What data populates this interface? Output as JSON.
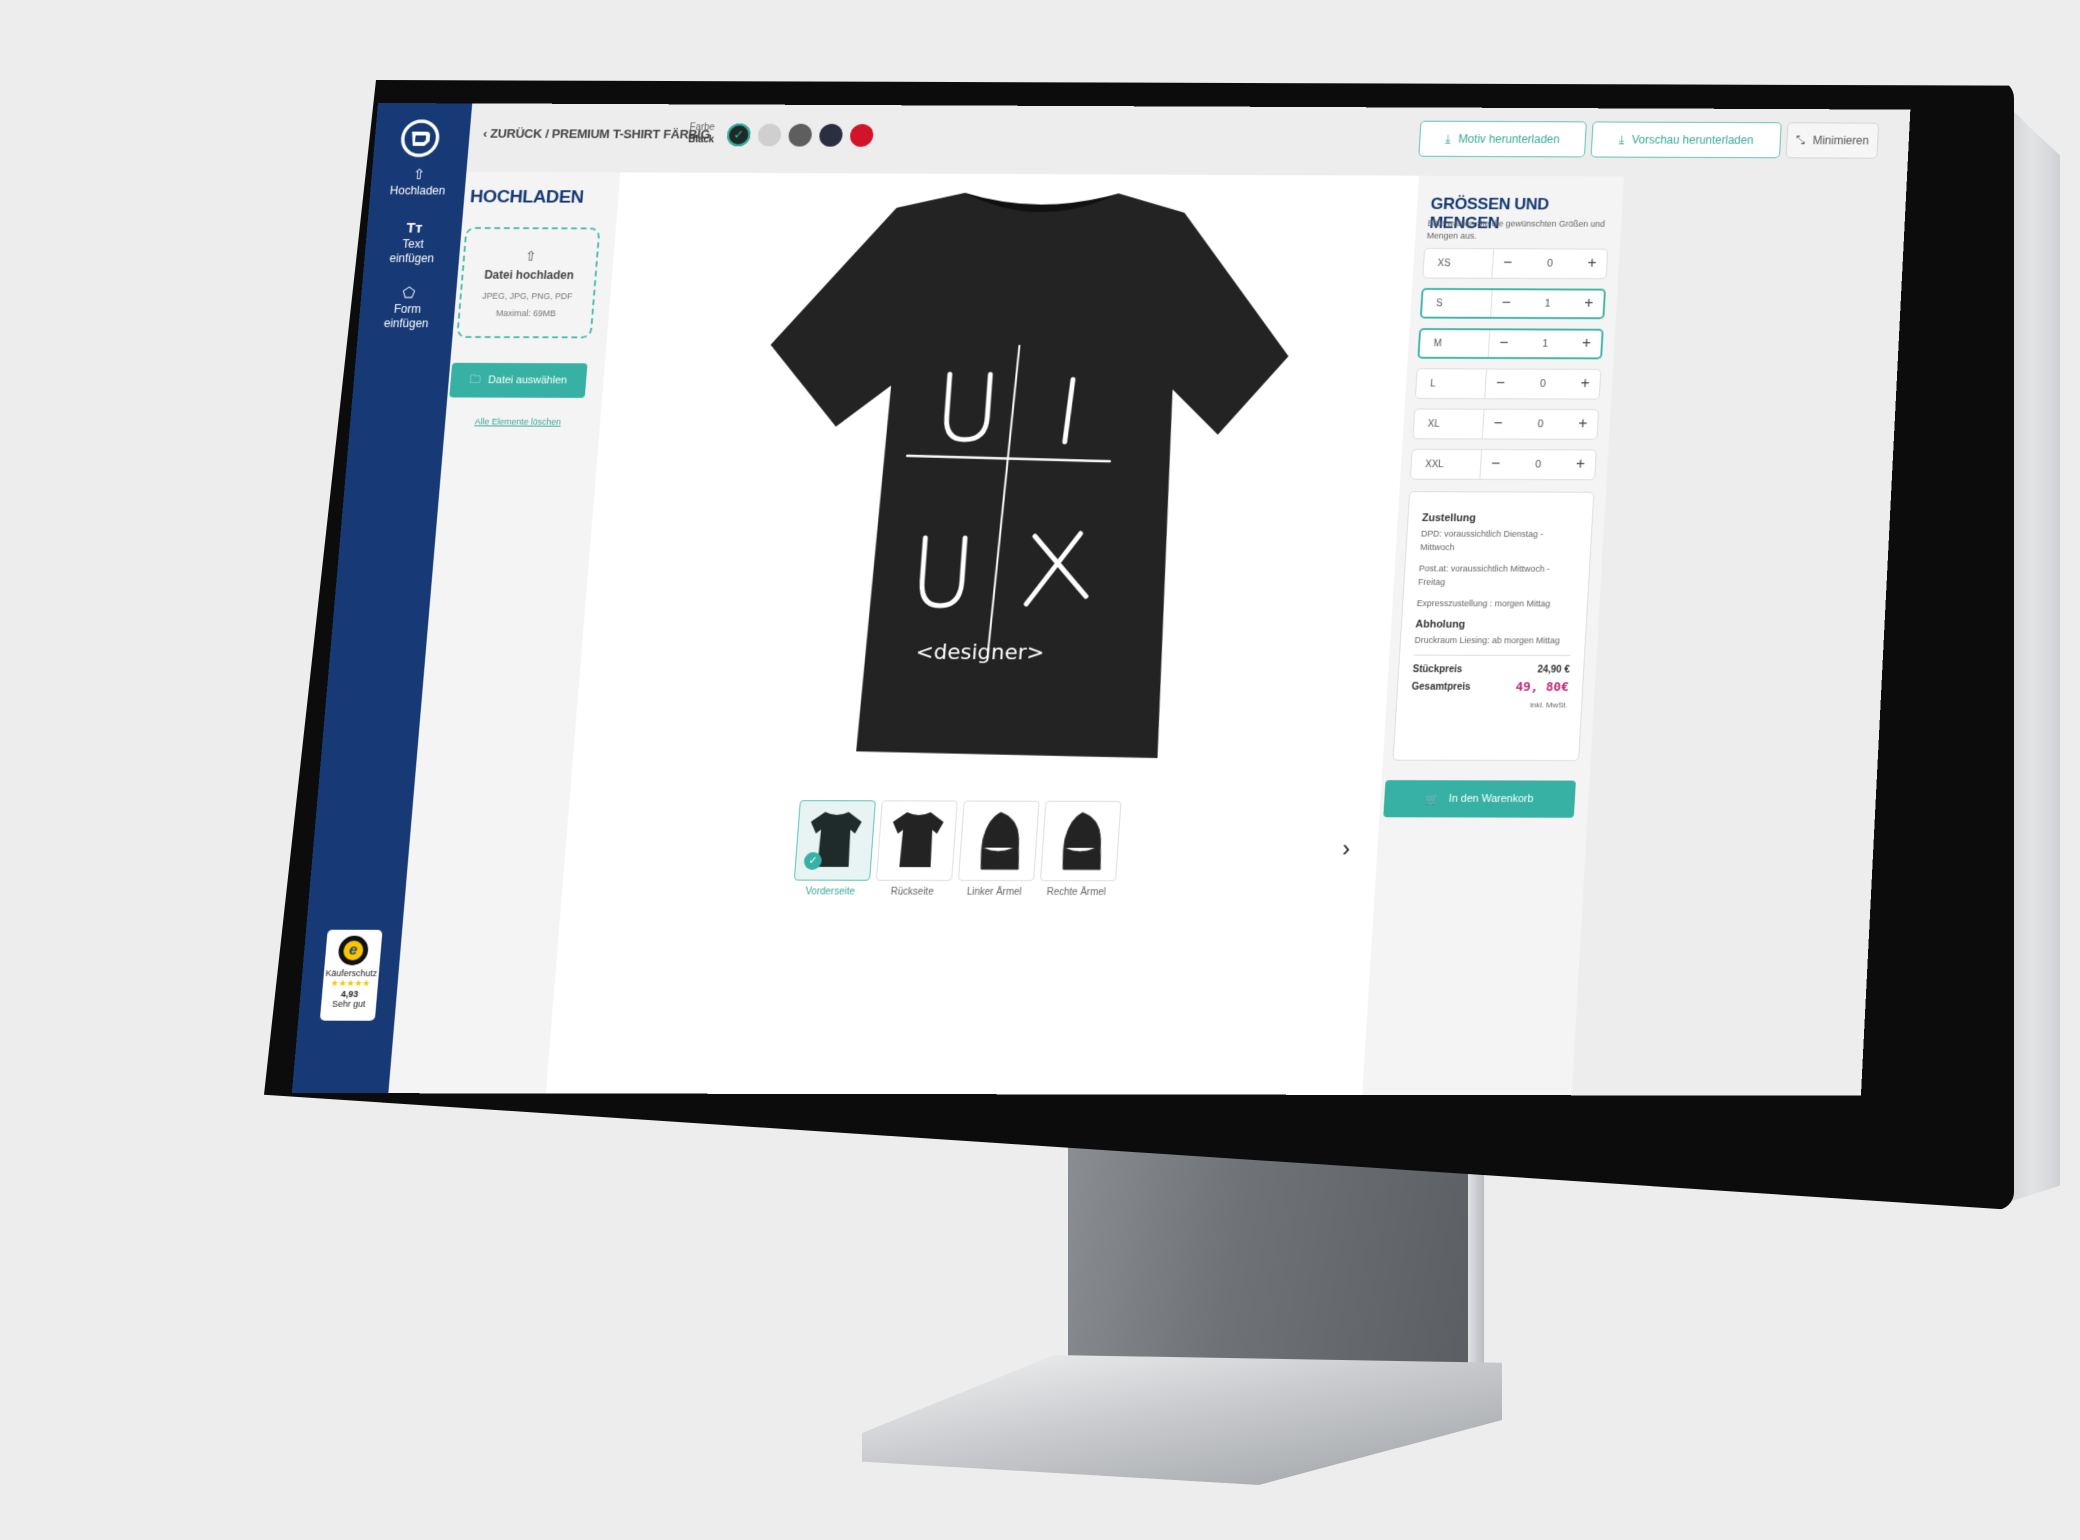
{
  "breadcrumb": {
    "back_label": "ZURÜCK",
    "separator": "/",
    "current": "PREMIUM T-SHIRT FÄRBIG"
  },
  "color_picker": {
    "label": "Farbe",
    "selected_name": "Black",
    "swatches": [
      {
        "name": "Black",
        "hex": "#1e2a27",
        "selected": true
      },
      {
        "name": "Light Grey",
        "hex": "#cfcfcf",
        "selected": false
      },
      {
        "name": "Dark Grey",
        "hex": "#5e5e5e",
        "selected": false
      },
      {
        "name": "Navy",
        "hex": "#2b2d40",
        "selected": false
      },
      {
        "name": "Red",
        "hex": "#d0142a",
        "selected": false
      }
    ]
  },
  "toolbar": {
    "download_motif": "Motiv herunterladen",
    "download_preview": "Vorschau herunterladen",
    "minimize": "Minimieren"
  },
  "sidebar": {
    "items": [
      {
        "icon": "upload-icon",
        "label": "Hochladen"
      },
      {
        "icon": "text-icon",
        "label": "Text einfügen"
      },
      {
        "icon": "shape-icon",
        "label": "Form einfügen"
      }
    ],
    "trust_badge": {
      "label": "Käuferschutz",
      "stars": "★★★★★",
      "score": "4,93",
      "rating_text": "Sehr gut"
    }
  },
  "upload_panel": {
    "title": "HOCHLADEN",
    "dropzone_title": "Datei hochladen",
    "formats": "JPEG, JPG, PNG, PDF",
    "max_size": "Maximal: 69MB",
    "select_button": "Datei auswählen",
    "clear_link": "Alle Elemente löschen"
  },
  "canvas": {
    "design": {
      "letters": [
        "U",
        "I",
        "U",
        "X"
      ],
      "caption": "<designer>"
    },
    "views": [
      {
        "label": "Vorderseite",
        "selected": true
      },
      {
        "label": "Rückseite",
        "selected": false
      },
      {
        "label": "Linker Ärmel",
        "selected": false
      },
      {
        "label": "Rechte Ärmel",
        "selected": false
      }
    ]
  },
  "sizes_panel": {
    "title": "GRÖSSEN UND MENGEN",
    "subtitle": "Bitte wählen Sie die gewünschten Größen und Mengen aus.",
    "sizes": [
      {
        "size": "XS",
        "qty": "0",
        "active": false
      },
      {
        "size": "S",
        "qty": "1",
        "active": true
      },
      {
        "size": "M",
        "qty": "1",
        "active": true
      },
      {
        "size": "L",
        "qty": "0",
        "active": false
      },
      {
        "size": "XL",
        "qty": "0",
        "active": false
      },
      {
        "size": "XXL",
        "qty": "0",
        "active": false
      }
    ],
    "delivery_title": "Zustellung",
    "delivery_lines": [
      "DPD: voraussichtlich Dienstag - Mittwoch",
      "Post.at: voraussichtlich Mittwoch - Freitag",
      "Expresszustellung : morgen Mittag"
    ],
    "pickup_title": "Abholung",
    "pickup_line": "Druckraum Liesing: ab morgen Mittag",
    "unit_price_label": "Stückpreis",
    "unit_price": "24,90 €",
    "total_label": "Gesamtpreis",
    "total_price": "49, 80€",
    "vat_note": "inkl. MwSt.",
    "cart_button": "In den Warenkorb"
  },
  "colors": {
    "brand_navy": "#173a76",
    "accent_teal": "#36b1a3",
    "total_magenta": "#c02a78"
  }
}
